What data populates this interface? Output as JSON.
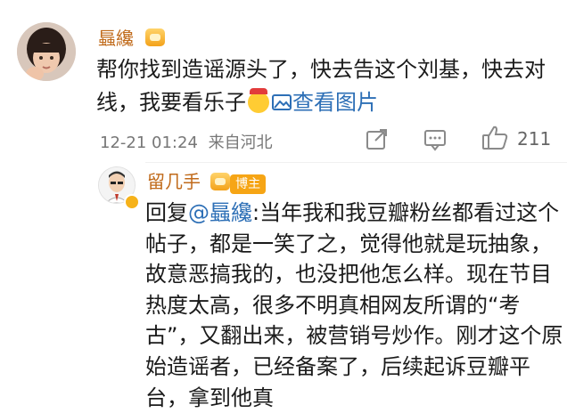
{
  "comment": {
    "user_name": "螶纔",
    "text_main": "帮你找到造谣源头了，快去告这个刘基，快去对线，我要看乐子",
    "view_image_label": "查看图片",
    "timestamp": "12-21 01:24",
    "location": "来自河北",
    "like_count": "211"
  },
  "reply": {
    "user_name": "留几手",
    "badge_label": "博主",
    "reply_prefix": "回复",
    "mention": "@螶纔",
    "text": ":当年我和我豆瓣粉丝都看过这个帖子，都是一笑了之，觉得他就是玩抽象，故意恶搞我的，也没把他怎么样。现在节目热度太高，很多不明真相网友所谓的“考古”，又翻出来，被营销号炒作。刚才这个原始造谣者，已经备案了，后续起诉豆瓣平台，拿到他真"
  },
  "colors": {
    "username": "#c06a1a",
    "link": "#2d6fb6",
    "badge": "#f6a515"
  }
}
